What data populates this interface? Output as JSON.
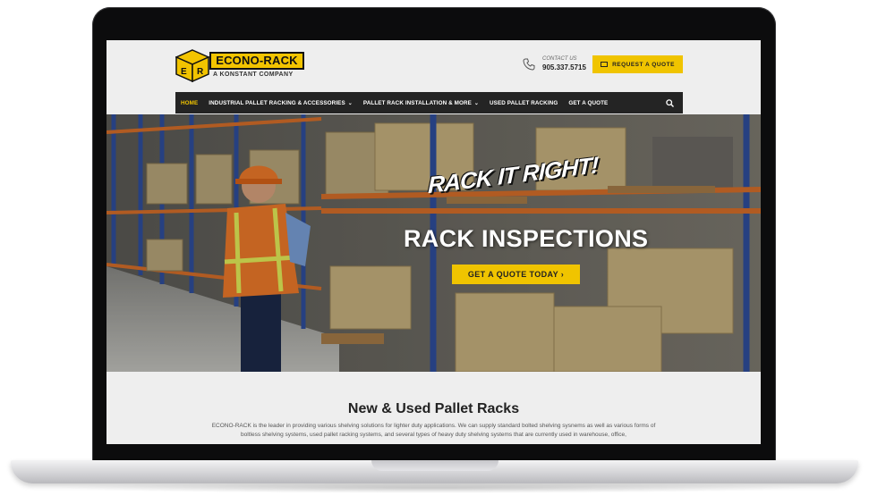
{
  "logo": {
    "cube_letters": [
      "E",
      "R"
    ],
    "brand": "ECONO-RACK",
    "tagline": "A KONSTANT COMPANY"
  },
  "contact": {
    "label": "CONTACT US",
    "phone": "905.337.5715"
  },
  "header": {
    "quote_button": "REQUEST A QUOTE"
  },
  "nav": {
    "items": [
      {
        "label": "HOME",
        "active": true
      },
      {
        "label": "INDUSTRIAL PALLET RACKING & ACCESSORIES",
        "caret": true
      },
      {
        "label": "PALLET RACK INSTALLATION & MORE",
        "caret": true
      },
      {
        "label": "USED PALLET RACKING"
      },
      {
        "label": "GET A QUOTE"
      }
    ],
    "caret_glyph": "⌄"
  },
  "hero": {
    "brand_text": "RACK IT RIGHT!",
    "title": "RACK INSPECTIONS",
    "cta": "GET A QUOTE TODAY ›"
  },
  "content": {
    "title": "New & Used Pallet Racks",
    "body": "ECONO-RACK is the leader in providing various shelving solutions for lighter duty applications. We can supply standard bolted shelving sysnems as well as various forms of boltless shelving systems, used pallet racking systems, and several types of heavy duty shelving systems that are currently used in warehouse, office,"
  },
  "colors": {
    "accent": "#f0c400",
    "nav_bg": "#242424",
    "rack_blue": "#2f4f9e",
    "rack_orange": "#d8702a"
  },
  "icons": [
    "phone-icon",
    "envelope-icon",
    "search-icon",
    "caret-down-icon"
  ]
}
